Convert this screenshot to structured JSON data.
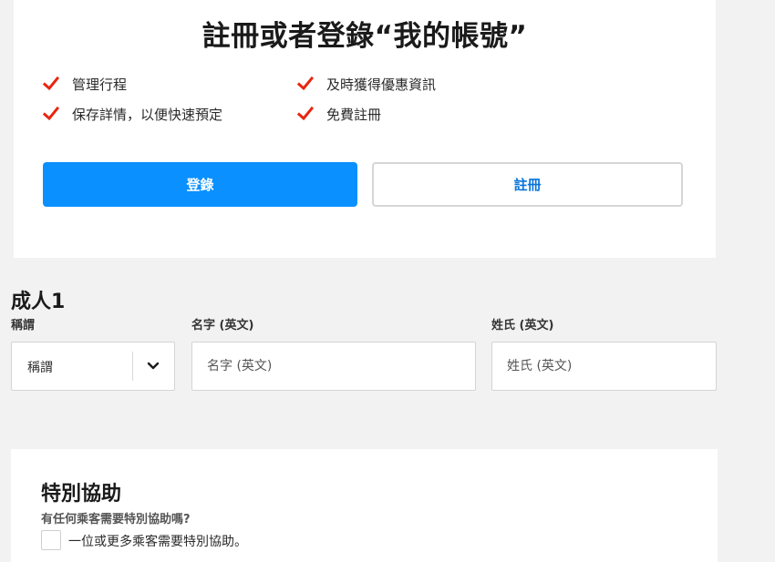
{
  "signin": {
    "title": "註冊或者登錄“我的帳號”",
    "benefits": [
      "管理行程",
      "保存詳情，以便快速預定",
      "及時獲得優惠資訊",
      "免費註冊"
    ],
    "login_label": "登錄",
    "register_label": "註冊",
    "check_color": "#e8260f",
    "accent_color": "#0a90ff"
  },
  "passenger": {
    "heading": "成人1",
    "title_label": "稱謂",
    "title_value": "稱謂",
    "first_name_label": "名字 (英文)",
    "first_name_placeholder": "名字 (英文)",
    "last_name_label": "姓氏 (英文)",
    "last_name_placeholder": "姓氏 (英文)"
  },
  "assistance": {
    "heading": "特別協助",
    "question": "有任何乘客需要特別協助嗎?",
    "checkbox_label": "一位或更多乘客需要特別協助。",
    "checked": false
  }
}
